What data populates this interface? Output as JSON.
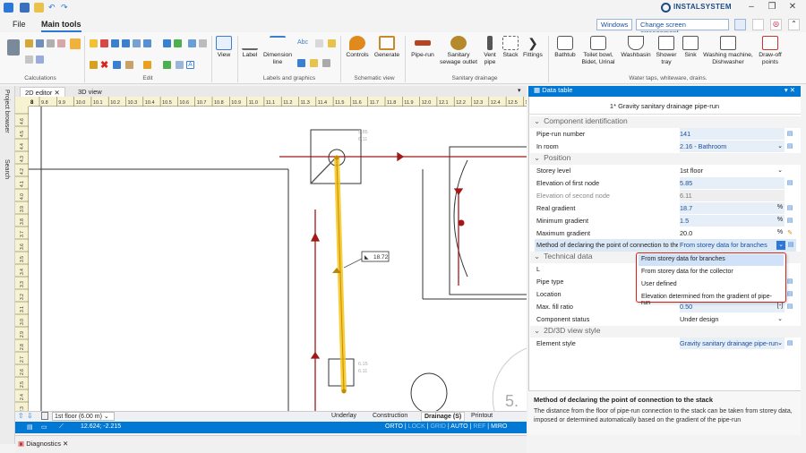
{
  "app": {
    "brand": "INSTALSYSTEM"
  },
  "menu": {
    "file": "File",
    "main_tools": "Main tools",
    "windows": "Windows",
    "change_layout": "Change screen arrangement"
  },
  "ribbon": {
    "groups": {
      "calculations": "Calculations",
      "edit": "Edit",
      "labels": "Labels and graphics",
      "schematic": "Schematic view",
      "sanitary": "Sanitary drainage",
      "water": "Water taps, whiteware, drains."
    },
    "view": "View",
    "label": "Label",
    "dimension": "Dimension line",
    "controls": "Controls",
    "generate": "Generate",
    "pipe_run": "Pipe-run",
    "sewage_outlet": "Sanitary sewage outlet",
    "vent_pipe": "Vent pipe",
    "stack": "Stack",
    "fittings": "Fittings",
    "bathtub": "Bathtub",
    "toilet": "Toilet bowl, Bidet, Urinal",
    "washbasin": "Washbasin",
    "shower": "Shower tray",
    "sink": "Sink",
    "washing": "Washing machine, Dishwasher",
    "drawoff": "Draw-off points"
  },
  "editor": {
    "tab_2d": "2D editor",
    "tab_3d": "3D view",
    "side_project": "Project browser",
    "side_search": "Search",
    "ruler": [
      "9.8",
      "9.9",
      "10.0",
      "10.1",
      "10.2",
      "10.3",
      "10.4",
      "10.5",
      "10.6",
      "10.7",
      "10.8",
      "10.9",
      "11.0",
      "11.1",
      "11.2",
      "11.3",
      "11.4",
      "11.5",
      "11.6",
      "11.7",
      "11.8",
      "11.9",
      "12.0",
      "12.1",
      "12.2",
      "12.3",
      "12.4",
      "12.5",
      "12.6"
    ],
    "ruler_first": "8",
    "vruler": [
      "4.6",
      "4.5",
      "4.4",
      "4.3",
      "4.2",
      "4.1",
      "4.0",
      "3.9",
      "3.8",
      "3.7",
      "3.6",
      "3.5",
      "3.4",
      "3.3",
      "3.2",
      "3.1",
      "3.0",
      "2.9",
      "2.8",
      "2.7",
      "2.6",
      "2.5",
      "2.4",
      "2.3"
    ],
    "gradient_label": "18.72",
    "tag_top": "5.85",
    "tag_top2": "6.11",
    "tag_bot": "6.15",
    "tag_bot2": "6.11",
    "big_digit": "5.",
    "floor": "1st floor (6.00 m)",
    "underlay": "Underlay",
    "construction": "Construction",
    "drainage": "Drainage (S)",
    "printout": "Printout",
    "coords": "12.624; -2.215",
    "modes": [
      "ORTO",
      "LOCK",
      "GRID",
      "AUTO",
      "REF",
      "MIRO"
    ],
    "diagnostics": "Diagnostics"
  },
  "panel": {
    "header": "Data table",
    "title": "1* Gravity sanitary drainage pipe-run",
    "sections": {
      "ident": "Component identification",
      "position": "Position",
      "tech": "Technical data",
      "view": "2D/3D view style"
    },
    "rows": {
      "pipe_run_number": {
        "k": "Pipe-run number",
        "v": "141"
      },
      "in_room": {
        "k": "In room",
        "v": "2.16 - Bathroom"
      },
      "storey": {
        "k": "Storey level",
        "v": "1st floor"
      },
      "elev1": {
        "k": "Elevation of first node",
        "v": "5.85"
      },
      "elev2": {
        "k": "Elevation of second node",
        "v": "6.11"
      },
      "real_grad": {
        "k": "Real gradient",
        "v": "18.7",
        "u": "%"
      },
      "min_grad": {
        "k": "Minimum gradient",
        "v": "1.5",
        "u": "%"
      },
      "max_grad": {
        "k": "Maximum gradient",
        "v": "20.0",
        "u": "%"
      },
      "method": {
        "k": "Method of declaring the point of connection to the",
        "v": "From storey data for branches"
      },
      "l": {
        "k": "L"
      },
      "pipe_type": {
        "k": "Pipe type"
      },
      "location": {
        "k": "Location"
      },
      "fill": {
        "k": "Max. fill ratio",
        "v": "0.50"
      },
      "status": {
        "k": "Component status",
        "v": "Under design"
      },
      "style": {
        "k": "Element style",
        "v": "Gravity sanitary drainage pipe-run"
      }
    },
    "dropdown": [
      "From storey data for branches",
      "From storey data for the collector",
      "User defined",
      "Elevation determined from the gradient of pipe-run"
    ],
    "desc_title": "Method of declaring the point of connection to the stack",
    "desc_body": "The distance from the floor of pipe-run connection to the stack can be taken from storey data, imposed or determined automatically based on the gradient of the pipe-run"
  },
  "colors": {
    "accent": "#0078d4",
    "pipe": "#a01818",
    "highlight": "#f5c518",
    "dropdown_border": "#d61f1f"
  }
}
